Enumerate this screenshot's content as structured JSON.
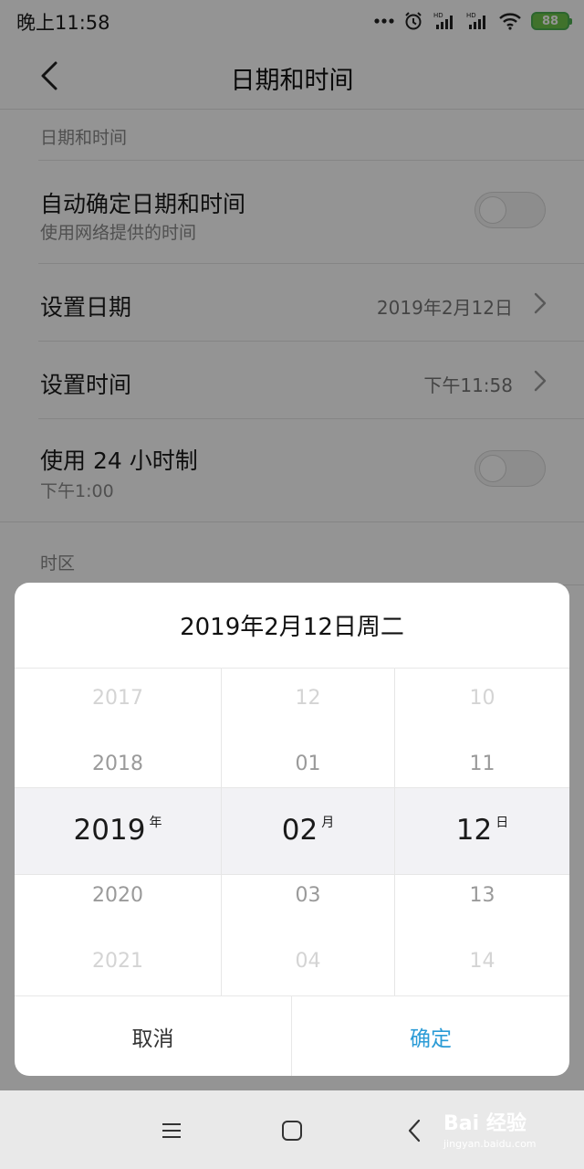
{
  "status_bar": {
    "time": "晚上11:58",
    "battery": "88",
    "icons": [
      "dots-icon",
      "alarm-icon",
      "signal-hd-icon",
      "signal-hd-icon",
      "wifi-icon",
      "battery-icon"
    ],
    "hd_label": "HD"
  },
  "header": {
    "title": "日期和时间",
    "back_icon": "chevron-left-icon"
  },
  "sections": {
    "datetime_header": "日期和时间",
    "timezone_header": "时区"
  },
  "rows": {
    "auto": {
      "title": "自动确定日期和时间",
      "subtitle": "使用网络提供的时间",
      "on": false
    },
    "set_date": {
      "title": "设置日期",
      "value": "2019年2月12日"
    },
    "set_time": {
      "title": "设置时间",
      "value": "下午11:58"
    },
    "h24": {
      "title": "使用 24 小时制",
      "subtitle": "下午1:00",
      "on": false
    }
  },
  "dialog": {
    "title": "2019年2月12日周二",
    "year": {
      "items": [
        "2017",
        "2018",
        "2019",
        "2020",
        "2021"
      ],
      "unit": "年"
    },
    "month": {
      "items": [
        "12",
        "01",
        "02",
        "03",
        "04"
      ],
      "unit": "月"
    },
    "day": {
      "items": [
        "10",
        "11",
        "12",
        "13",
        "14"
      ],
      "unit": "日"
    },
    "cancel": "取消",
    "confirm": "确定"
  },
  "colors": {
    "accent": "#2a9bd6",
    "battery": "#6ec54a",
    "scrim": "rgba(0,0,0,0.42)"
  },
  "navbar": {
    "icons": [
      "menu-icon",
      "home-icon",
      "back-icon"
    ]
  },
  "watermark": {
    "main": "Bai 经验",
    "sub": "jingyan.baidu.com"
  }
}
